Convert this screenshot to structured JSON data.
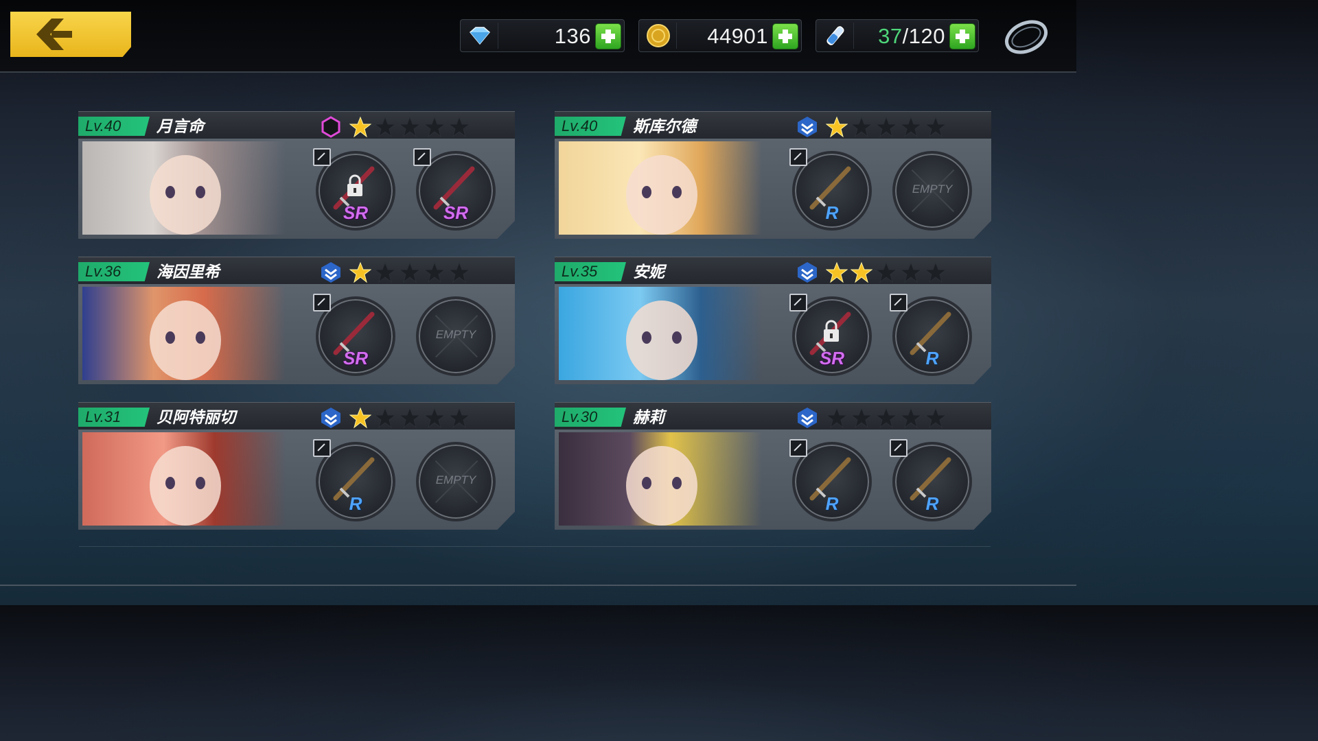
{
  "topbar": {
    "back_icon": "chevron-left-icon",
    "resources": [
      {
        "icon": "diamond-icon",
        "value": "136"
      },
      {
        "icon": "gold-coin-icon",
        "value": "44901"
      },
      {
        "icon": "stamina-vial-icon",
        "current": "37",
        "max": "/120"
      }
    ],
    "settings_icon": "ring-menu-icon"
  },
  "colors": {
    "accent_yellow": "#f2c53a",
    "level_green": "#23c37b",
    "sr_purple": "#d36cf0",
    "r_blue": "#4fa4ff",
    "star_gold": "#f7c324"
  },
  "characters": [
    {
      "level": "Lv.40",
      "name": "月言命",
      "rank_icon": "hexagon-rank-icon",
      "stars": 1,
      "slots": [
        {
          "type": "weapon",
          "rarity": "SR",
          "locked": true
        },
        {
          "type": "weapon",
          "rarity": "SR",
          "locked": false
        }
      ]
    },
    {
      "level": "Lv.40",
      "name": "斯库尔德",
      "rank_icon": "chevron-rank-icon",
      "stars": 1,
      "slots": [
        {
          "type": "weapon",
          "rarity": "R",
          "locked": false
        },
        {
          "type": "empty",
          "label": "EMPTY"
        }
      ]
    },
    {
      "level": "Lv.36",
      "name": "海因里希",
      "rank_icon": "chevron-rank-icon",
      "stars": 1,
      "slots": [
        {
          "type": "weapon",
          "rarity": "SR",
          "locked": false
        },
        {
          "type": "empty",
          "label": "EMPTY"
        }
      ]
    },
    {
      "level": "Lv.35",
      "name": "安妮",
      "rank_icon": "chevron-rank-icon",
      "stars": 2,
      "slots": [
        {
          "type": "weapon",
          "rarity": "SR",
          "locked": true
        },
        {
          "type": "weapon",
          "rarity": "R",
          "locked": false
        }
      ]
    },
    {
      "level": "Lv.31",
      "name": "贝阿特丽切",
      "rank_icon": "chevron-rank-icon",
      "stars": 1,
      "slots": [
        {
          "type": "weapon",
          "rarity": "R",
          "locked": false
        },
        {
          "type": "empty",
          "label": "EMPTY"
        }
      ]
    },
    {
      "level": "Lv.30",
      "name": "赫莉",
      "rank_icon": "chevron-rank-icon",
      "stars": 0,
      "slots": [
        {
          "type": "weapon",
          "rarity": "R",
          "locked": false
        },
        {
          "type": "weapon",
          "rarity": "R",
          "locked": false
        }
      ]
    }
  ]
}
